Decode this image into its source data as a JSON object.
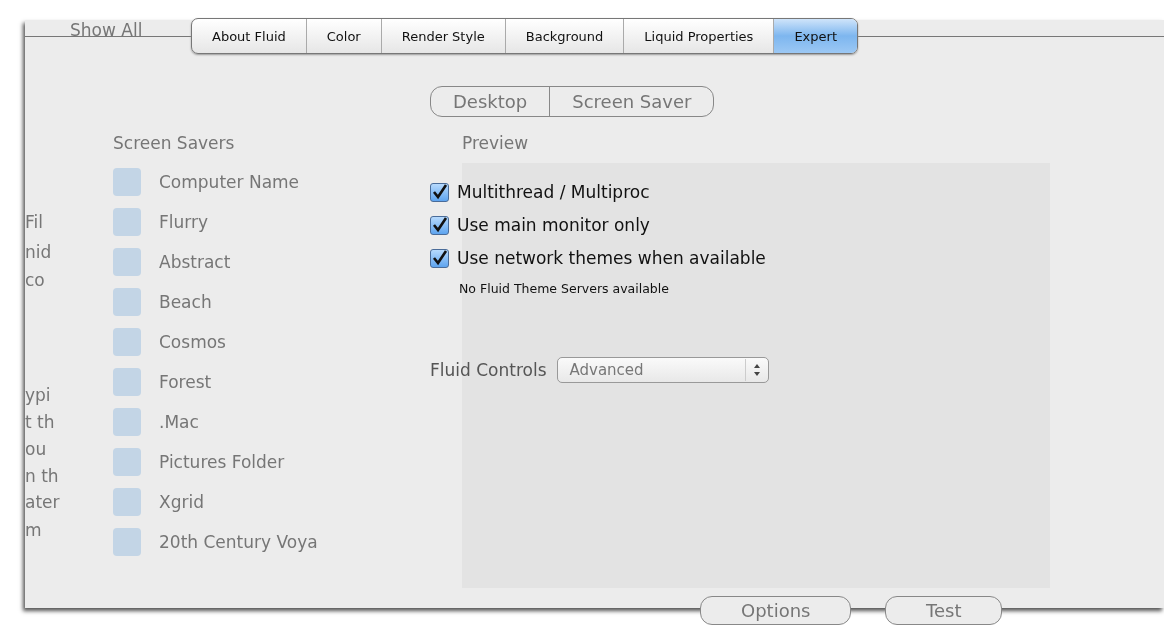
{
  "tabs": [
    {
      "label": "About Fluid",
      "selected": false
    },
    {
      "label": "Color",
      "selected": false
    },
    {
      "label": "Render Style",
      "selected": false
    },
    {
      "label": "Background",
      "selected": false
    },
    {
      "label": "Liquid Properties",
      "selected": false
    },
    {
      "label": "Expert",
      "selected": true
    }
  ],
  "options": [
    {
      "label": "Multithread / Multiproc",
      "checked": true
    },
    {
      "label": "Use main monitor only",
      "checked": true
    },
    {
      "label": "Use network themes when available",
      "checked": true
    }
  ],
  "status_note": "No Fluid Theme Servers available",
  "fluid_controls": {
    "label": "Fluid Controls",
    "value": "Advanced"
  },
  "background_window": {
    "toolbar_button": "Show All",
    "segments": [
      {
        "label": "Desktop"
      },
      {
        "label": "Screen Saver"
      }
    ],
    "list_title": "Screen Savers",
    "preview_title": "Preview",
    "savers": [
      {
        "label": "Computer Name"
      },
      {
        "label": "Flurry"
      },
      {
        "label": "Abstract"
      },
      {
        "label": "Beach"
      },
      {
        "label": "Cosmos"
      },
      {
        "label": "Forest"
      },
      {
        "label": ".Mac"
      },
      {
        "label": "Pictures Folder"
      },
      {
        "label": "Xgrid"
      },
      {
        "label": "20th Century Voya"
      }
    ],
    "buttons": [
      "Options",
      "Test"
    ],
    "left_fragments": [
      "Fil",
      "nid",
      "co",
      "ypi",
      "t th",
      "ou",
      "n th",
      "ater",
      "m"
    ]
  }
}
